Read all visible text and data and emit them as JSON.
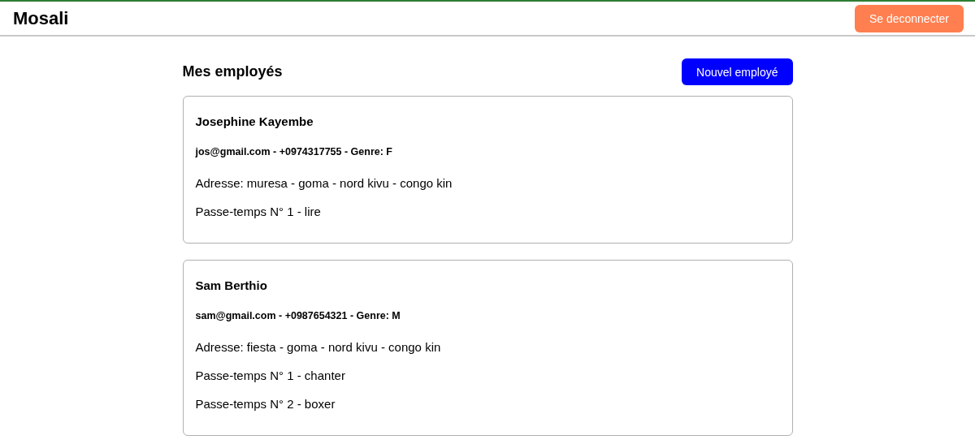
{
  "header": {
    "logo": "Mosali",
    "logout_button": "Se deconnecter"
  },
  "page": {
    "title": "Mes employés",
    "new_button": "Nouvel employé"
  },
  "employees": [
    {
      "name": "Josephine Kayembe",
      "contact": "jos@gmail.com - +0974317755 - Genre: F",
      "address": "Adresse: muresa - goma - nord kivu - congo kin",
      "hobbies": [
        "Passe-temps N° 1 - lire"
      ]
    },
    {
      "name": "Sam Berthio",
      "contact": "sam@gmail.com - +0987654321 - Genre: M",
      "address": "Adresse: fiesta - goma - nord kivu - congo kin",
      "hobbies": [
        "Passe-temps N° 1 - chanter",
        "Passe-temps N° 2 - boxer"
      ]
    }
  ]
}
